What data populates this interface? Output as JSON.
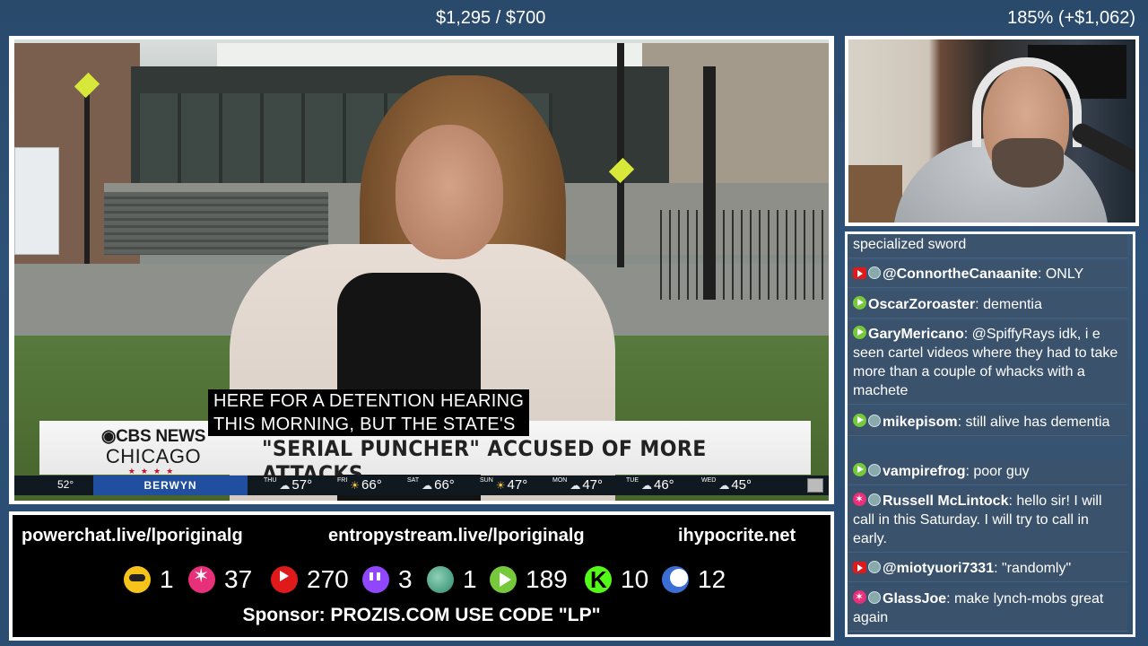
{
  "topbar": {
    "goal": "$1,295 / $700",
    "percent": "185% (+$1,062)"
  },
  "video": {
    "caption_line1": "HERE FOR A DETENTION HEARING",
    "caption_line2": "THIS MORNING, BUT THE STATE'S",
    "logo_line1": "CBS NEWS",
    "logo_line2": "CHICAGO",
    "logo_stars": "★★★★",
    "headline": "\"SERIAL PUNCHER\" ACCUSED OF MORE ATTACKS",
    "weather": {
      "current_temp": "52°",
      "city": "BERWYN",
      "days": [
        {
          "day": "THU",
          "icon": "cloud-icon",
          "temp": "57°"
        },
        {
          "day": "FRI",
          "icon": "sun-icon",
          "temp": "66°"
        },
        {
          "day": "SAT",
          "icon": "cloud-icon",
          "temp": "66°"
        },
        {
          "day": "SUN",
          "icon": "sun-icon",
          "temp": "47°"
        },
        {
          "day": "MON",
          "icon": "cloud-icon",
          "temp": "47°"
        },
        {
          "day": "TUE",
          "icon": "cloud-icon",
          "temp": "46°"
        },
        {
          "day": "WED",
          "icon": "cloud-icon",
          "temp": "45°"
        }
      ]
    }
  },
  "chat": {
    "messages": [
      {
        "user": "",
        "text": "specialized sword",
        "badges": []
      },
      {
        "user": "@ConnortheCanaanite",
        "text": ": ONLY",
        "badges": [
          "youtube",
          "avatar"
        ]
      },
      {
        "user": "OscarZoroaster",
        "text": ": dementia",
        "badges": [
          "rumble"
        ]
      },
      {
        "user": "GaryMericano",
        "text": ": @SpiffyRays idk, i e seen cartel videos where they had to take more than a couple of whacks with a machete",
        "badges": [
          "rumble"
        ]
      },
      {
        "user": "mikepisom",
        "text": ": still alive has dementia",
        "badges": [
          "rumble",
          "avatar"
        ]
      },
      {
        "user": "vampirefrog",
        "text": ": poor guy",
        "badges": [
          "rumble",
          "avatar"
        ]
      },
      {
        "user": "Russell McLintock",
        "text": ": hello sir! I will call in this Saturday. I will try to call in early.",
        "badges": [
          "kick",
          "avatar"
        ]
      },
      {
        "user": "@miotyuori7331",
        "text": ": \"randomly\"",
        "badges": [
          "youtube",
          "avatar"
        ]
      },
      {
        "user": "GlassJoe",
        "text": ": make lynch-mobs great again",
        "badges": [
          "kick",
          "avatar"
        ]
      }
    ]
  },
  "bottom": {
    "links": [
      "powerchat.live/lporiginalg",
      "entropystream.live/lporiginalg",
      "ihypocrite.net"
    ],
    "stats": [
      {
        "icon": "among-us-icon",
        "count": "1"
      },
      {
        "icon": "kick-splat-icon",
        "count": "37"
      },
      {
        "icon": "youtube-icon",
        "count": "270"
      },
      {
        "icon": "twitch-icon",
        "count": "3"
      },
      {
        "icon": "globe-icon",
        "count": "1"
      },
      {
        "icon": "rumble-icon",
        "count": "189"
      },
      {
        "icon": "kick-k-icon",
        "count": "10"
      },
      {
        "icon": "moon-icon",
        "count": "12"
      }
    ],
    "sponsor": "Sponsor: PROZIS.COM USE CODE \"LP\""
  }
}
